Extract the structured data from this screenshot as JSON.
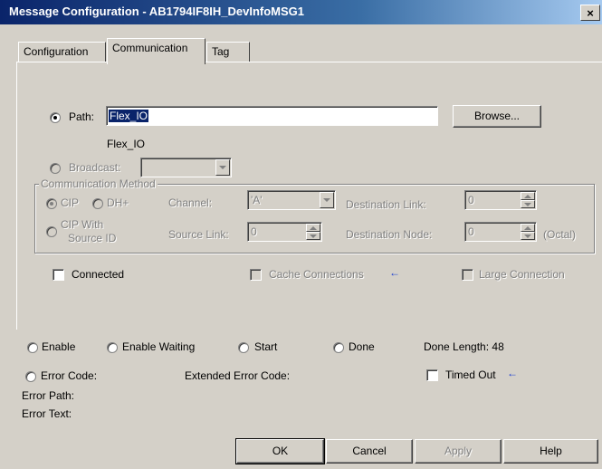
{
  "window": {
    "title": "Message Configuration - AB1794IF8IH_DevInfoMSG1",
    "close_glyph": "×"
  },
  "tabs": [
    {
      "label": "Configuration",
      "active": false
    },
    {
      "label": "Communication",
      "active": true
    },
    {
      "label": "Tag",
      "active": false
    }
  ],
  "path": {
    "label": "Path:",
    "value": "Flex_IO",
    "resolved": "Flex_IO",
    "browse_label": "Browse...",
    "selected": true
  },
  "broadcast": {
    "label": "Broadcast:",
    "value": "",
    "enabled": false
  },
  "comm_method": {
    "legend": "Communication Method",
    "cip_label": "CIP",
    "dhplus_label": "DH+",
    "channel_label": "Channel:",
    "channel_value": "'A'",
    "dest_link_label": "Destination Link:",
    "dest_link_value": "0",
    "cip_source_line1": "CIP With",
    "cip_source_line2": "Source ID",
    "source_link_label": "Source Link:",
    "source_link_value": "0",
    "dest_node_label": "Destination Node:",
    "dest_node_value": "0",
    "octal_label": "(Octal)"
  },
  "options": {
    "connected_label": "Connected",
    "cache_label": "Cache Connections",
    "large_label": "Large Connection",
    "arrow_glyph": "←"
  },
  "status": {
    "enable": "Enable",
    "enable_waiting": "Enable Waiting",
    "start": "Start",
    "done": "Done",
    "done_length": "Done Length: 48",
    "error_code": "Error Code:",
    "extended_error_code": "Extended Error Code:",
    "timed_out": "Timed Out",
    "error_path": "Error Path:",
    "error_text": "Error Text:"
  },
  "buttons": {
    "ok": "OK",
    "cancel": "Cancel",
    "apply": "Apply",
    "help": "Help"
  },
  "colors": {
    "titlebar": "#0a246a",
    "face": "#d4d0c8",
    "arrow": "#1c3fd0"
  }
}
